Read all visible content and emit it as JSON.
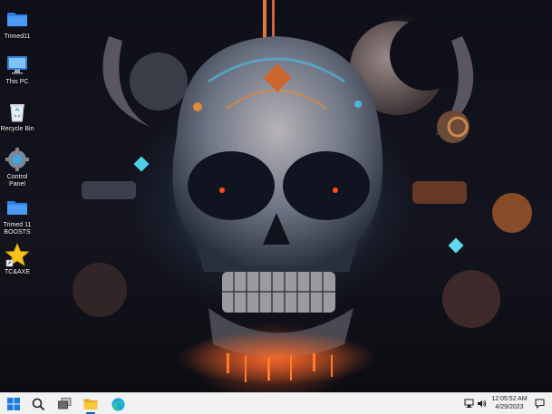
{
  "desktop": {
    "icons": [
      {
        "label": "Trimed11",
        "icon": "folder-icon"
      },
      {
        "label": "This PC",
        "icon": "monitor-icon"
      },
      {
        "label": "Recycle Bin",
        "icon": "recycle-bin-icon"
      },
      {
        "label": "Control Panel",
        "icon": "gear-icon"
      },
      {
        "label": "Trimed 11 BOOSTS",
        "icon": "folder-icon"
      },
      {
        "label": "TC&AXE",
        "icon": "star-icon"
      }
    ]
  },
  "taskbar": {
    "pinned": [
      {
        "name": "start",
        "icon": "windows-logo-icon"
      },
      {
        "name": "search",
        "icon": "search-icon"
      },
      {
        "name": "task-view",
        "icon": "task-view-icon"
      },
      {
        "name": "file-explorer",
        "icon": "folder-icon"
      },
      {
        "name": "edge",
        "icon": "edge-icon"
      }
    ],
    "tray": {
      "time": "12:05:52 AM",
      "date": "4/29/2023",
      "icons": [
        "network-icon",
        "volume-icon",
        "notification-icon"
      ]
    }
  },
  "colors": {
    "taskbar_bg": "#f0f1f3",
    "folder": "#3d8ef0",
    "accent": "#0067c0"
  }
}
